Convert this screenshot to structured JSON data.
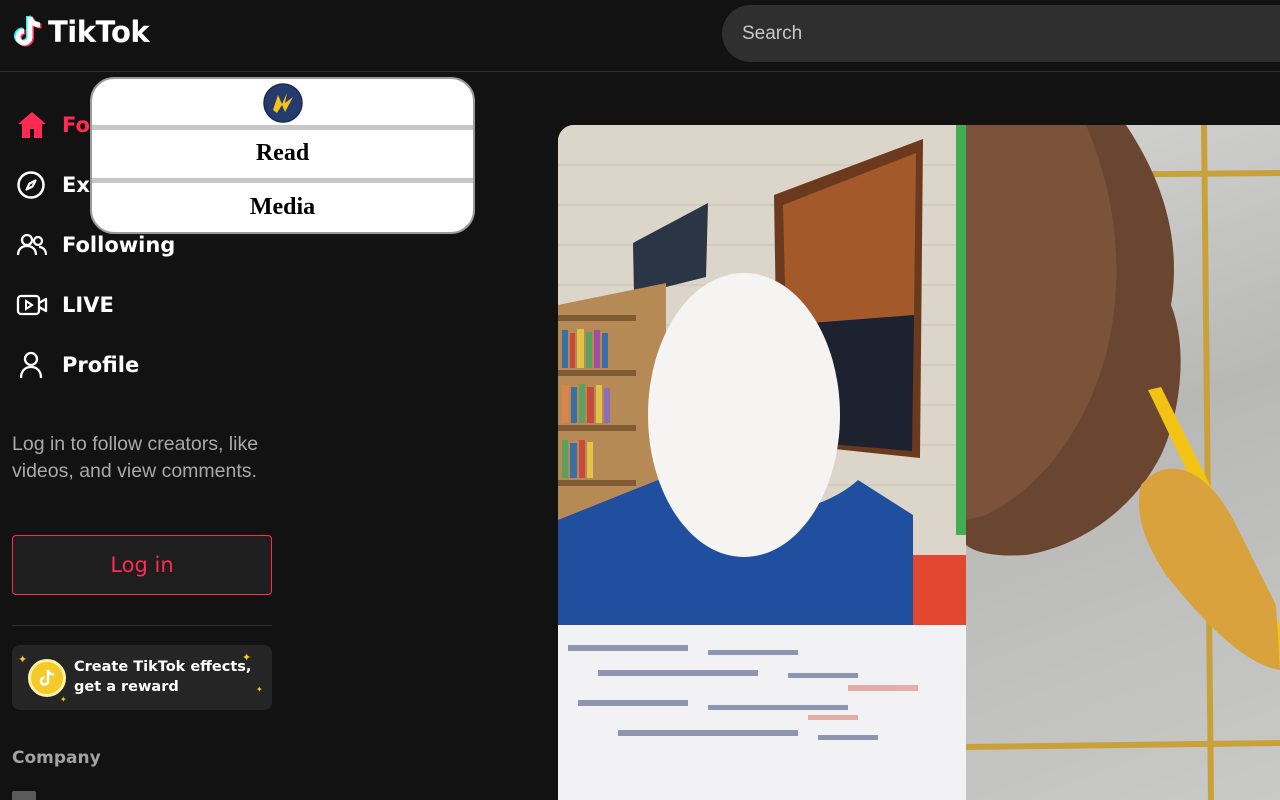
{
  "header": {
    "logo_text": "TikTok",
    "search_placeholder": "Search"
  },
  "sidebar": {
    "items": [
      {
        "label": "Fo",
        "icon": "home-icon",
        "active": true
      },
      {
        "label": "Ex",
        "icon": "compass-icon",
        "active": false
      },
      {
        "label": "Following",
        "icon": "following-icon",
        "active": false
      },
      {
        "label": "LIVE",
        "icon": "live-icon",
        "active": false
      },
      {
        "label": "Profile",
        "icon": "profile-icon",
        "active": false
      }
    ],
    "login_hint": "Log in to follow creators, like videos, and view comments.",
    "login_button": "Log in",
    "effects_promo": {
      "line1": "Create TikTok effects,",
      "line2": "get a reward"
    },
    "footer_heading": "Company"
  },
  "popup": {
    "logo_icon": "lightning-badge-icon",
    "read_label": "Read",
    "media_label": "Media"
  },
  "colors": {
    "brand_red": "#fe2c55",
    "background": "#121212",
    "search_bg": "#2f2f2f"
  }
}
